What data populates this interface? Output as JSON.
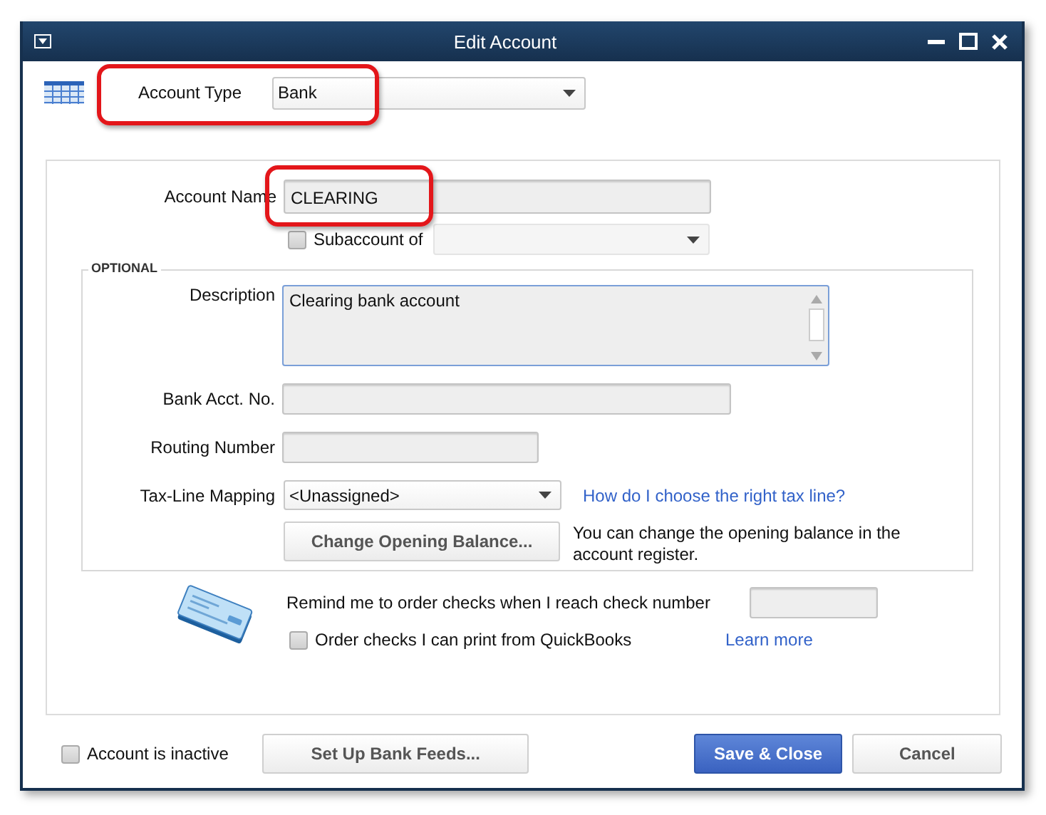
{
  "window": {
    "title": "Edit Account"
  },
  "account_type": {
    "label": "Account Type",
    "value": "Bank"
  },
  "account_name": {
    "label": "Account Name",
    "value": "CLEARING"
  },
  "subaccount": {
    "label": "Subaccount of",
    "checked": false
  },
  "optional": {
    "title": "OPTIONAL",
    "description": {
      "label": "Description",
      "value": "Clearing bank account"
    },
    "bank_acct_no": {
      "label": "Bank Acct. No."
    },
    "routing_number": {
      "label": "Routing Number"
    },
    "tax_line_mapping": {
      "label": "Tax-Line Mapping",
      "value": "<Unassigned>",
      "help_link": "How do I choose the right tax line?"
    },
    "opening_balance": {
      "button": "Change Opening Balance...",
      "note": "You can change the opening balance in the account register."
    }
  },
  "checks": {
    "reminder": "Remind me to order checks when I reach check number",
    "order": {
      "label": "Order checks I can print from QuickBooks",
      "checked": false
    },
    "learn_more": "Learn more"
  },
  "inactive": {
    "label": "Account is inactive",
    "checked": false
  },
  "buttons": [
    {
      "label": "Set Up Bank Feeds...",
      "kind": "normal"
    },
    {
      "label": "Save & Close",
      "kind": "primary"
    },
    {
      "label": "Cancel",
      "kind": "normal"
    }
  ]
}
